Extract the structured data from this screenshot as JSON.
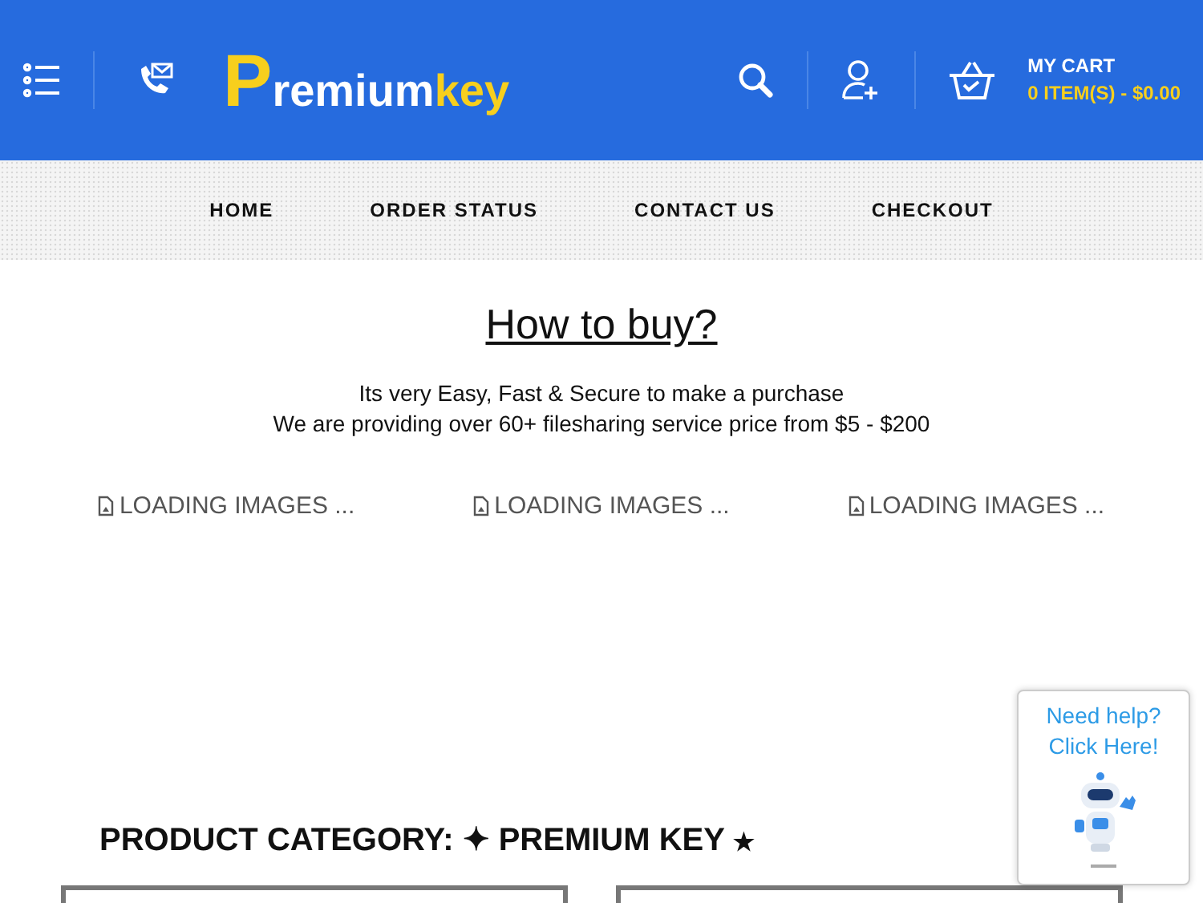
{
  "header": {
    "logo": {
      "initial": "P",
      "middle": "remium",
      "end": "key"
    },
    "cart": {
      "title": "MY CART",
      "summary": "0 ITEM(S) - $0.00"
    }
  },
  "nav": [
    {
      "label": "HOME"
    },
    {
      "label": "ORDER STATUS"
    },
    {
      "label": "CONTACT US"
    },
    {
      "label": "CHECKOUT"
    }
  ],
  "intro": {
    "title": "How to buy?",
    "lines": [
      "Its very Easy, Fast & Secure to make a purchase",
      "We are providing over 60+ filesharing service price from $5 - $200"
    ]
  },
  "loaders": [
    {
      "text": "LOADING IMAGES ..."
    },
    {
      "text": "LOADING IMAGES ..."
    },
    {
      "text": "LOADING IMAGES ..."
    }
  ],
  "category": {
    "label": "PRODUCT CATEGORY:",
    "mark": "✦",
    "name": "PREMIUM KEY",
    "star": "★",
    "cards": [
      {
        "kind": "placeholder"
      },
      {
        "kind": "placeholder"
      }
    ]
  },
  "help": {
    "lines": [
      "Need help?",
      "Click Here!"
    ]
  }
}
